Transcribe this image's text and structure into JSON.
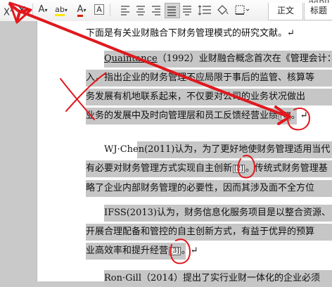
{
  "toolbar": {
    "superscript": "X",
    "superscript_mark": "2",
    "clear_format": "A",
    "highlight": "ab",
    "font_color": "A",
    "char_border": "A",
    "style_zhengwen": "正文",
    "style_biaoti": "标题",
    "style_partial": "AaBb"
  },
  "document": {
    "line1": "下面是有关业财融合下财务管理模式的研究文献。↵",
    "line2_author": "Quaintance",
    "line2_rest": "（1992）业财融合概念首次在《管理会计：",
    "line3": "入，指出企业的财务管理不应局限于事后的监管、核算等",
    "line4": "务发展有机地联系起来，不仅要对公司的业务状况做出",
    "line5_a": "业务的发展中及时向管理层和员工反馈经营业绩",
    "line5_ref": "[1]",
    "line5_b": "。↵",
    "line6": "WJ·Chen(2011)认为，为了更好地使财务管理适用当代",
    "line7_a": "有必要对财务管理方式实现自主创新",
    "line7_ref": "[2]",
    "line7_b": "。传统式财务管理基",
    "line8": "略了企业内部财务管理的必要性，因而其涉及面不全方位",
    "line9": "IFSS(2013)认为，财务信息化服务项目是以整合资源、",
    "line10": "开展合理配备和管控的自主创新方式，有益于优异的预算",
    "line11_a": "业高效率和提升经营",
    "line11_ref": "[3]",
    "line11_b": "。↵",
    "line12": "Ron·Gill（2014）提出了实行业财一体化的企业必须"
  },
  "colors": {
    "page": "#ffffff",
    "selection": "#c6c6c6",
    "annotation_red": "#e0191e",
    "font_color_red": "#d81e06",
    "highlight_yellow": "#ffe600"
  }
}
